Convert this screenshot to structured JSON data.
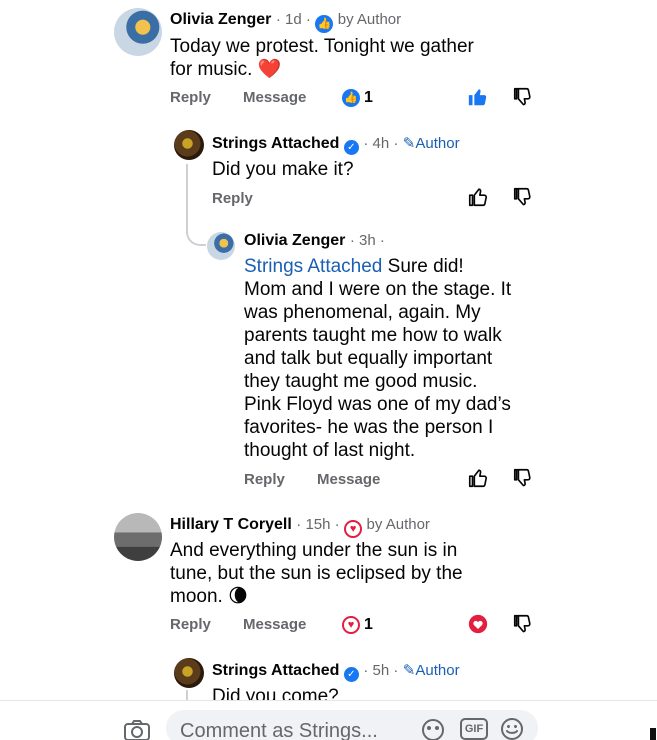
{
  "comments": [
    {
      "name": "Olivia Zenger",
      "time": "· 1d ·",
      "author_label": "by Author",
      "text_line1": "Today we protest. Tonight we gather",
      "text_line2": "for music.",
      "emoji": "❤️",
      "reply": "Reply",
      "message": "Message",
      "reaction_count": "1"
    },
    {
      "name": "Strings Attached",
      "time": "· 4h ·",
      "author_label": "Author",
      "text": "Did you make it?",
      "reply": "Reply"
    },
    {
      "name": "Olivia Zenger",
      "time": "· 3h ·",
      "mention": "Strings Attached",
      "lines": [
        " Sure did!",
        "Mom and I were on the stage. It",
        "was phenomenal, again. My",
        "parents taught me how to walk",
        "and talk but equally important",
        "they taught me good music.",
        "Pink Floyd was one of my dad’s",
        "favorites- he was the person I",
        "thought of last night."
      ],
      "reply": "Reply",
      "message": "Message"
    },
    {
      "name": "Hillary T Coryell",
      "time": "· 15h ·",
      "author_label": "by Author",
      "lines": [
        "And everything under the sun is in",
        "tune, but the sun is eclipsed by the",
        "moon."
      ],
      "emoji": "🌘",
      "reply": "Reply",
      "message": "Message",
      "reaction_count": "1"
    },
    {
      "name": "Strings Attached",
      "time": "· 5h ·",
      "author_label": "Author",
      "text": "Did you come?"
    }
  ],
  "composer": {
    "placeholder": "Comment as Strings..."
  },
  "colors": {
    "facebook_blue": "#1877f2",
    "link_blue": "#1a5fb4",
    "heart_red": "#e41e3f",
    "secondary_text": "#65676b"
  }
}
